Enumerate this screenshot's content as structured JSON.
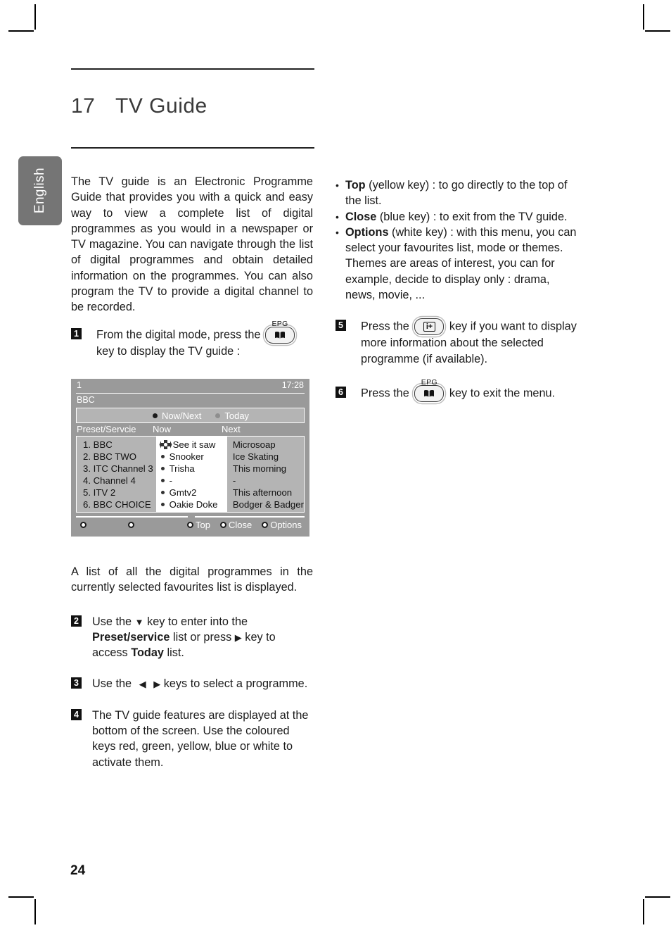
{
  "page": {
    "number": "24",
    "language_tab": "English",
    "chapter_number": "17",
    "chapter_title": "TV Guide"
  },
  "left_column": {
    "intro": "The TV guide is an Electronic Programme Guide that provides you with a quick and easy way to view a complete list of digital programmes as you would in a newspaper or TV magazine. You can navigate through the list of digital programmes and obtain detailed information on the programmes. You can also program the TV to provide a digital channel to be recorded.",
    "step1": {
      "badge": "1",
      "text_before": "From the digital mode, press the",
      "key_label": "EPG",
      "key_icon": "book-icon",
      "text_after": "key to display the TV guide :"
    },
    "after_screen": "A list of all the digital programmes in the currently selected favourites list is displayed.",
    "step2": {
      "badge": "2",
      "part1": "Use the",
      "arrow_down": "▼",
      "part2": "key to enter into the",
      "bold1": "Preset/service",
      "part3": "list or press",
      "arrow_right": "▶",
      "part4": "key to access",
      "bold2": "Today",
      "part5": "list."
    },
    "step3": {
      "badge": "3",
      "part1": "Use the",
      "arrow_left": "◀",
      "arrow_right": "▶",
      "part2": "keys to select a programme."
    },
    "step4": {
      "badge": "4",
      "text": "The TV guide features are displayed at the bottom of the screen. Use the coloured keys red, green, yellow, blue or white to activate them."
    }
  },
  "right_column": {
    "bullets": [
      {
        "bold": "Top",
        "rest": " (yellow key) : to go directly to the top of the list."
      },
      {
        "bold": "Close",
        "rest": " (blue key) : to exit from the TV guide."
      },
      {
        "bold": "Options",
        "rest": " (white key) : with this menu, you can select your favourites list, mode or themes. Themes are areas of interest, you can for example, decide to display only : drama, news, movie, ..."
      }
    ],
    "step5": {
      "badge": "5",
      "text_before": "Press the",
      "key_icon": "info-plus-icon",
      "key_glyph": "i+",
      "text_after": "key if you want to display more information about the selected programme (if available)."
    },
    "step6": {
      "badge": "6",
      "text_before": "Press the",
      "key_label": "EPG",
      "key_icon": "book-icon",
      "text_after": "key to exit the menu."
    }
  },
  "tv_guide_screen": {
    "preset_number": "1",
    "clock": "17:28",
    "channel": "BBC",
    "modes": [
      {
        "label": "Now/Next",
        "selected": true
      },
      {
        "label": "Today",
        "selected": false
      }
    ],
    "columns": [
      "Preset/Servcie",
      "Now",
      "Next"
    ],
    "rows": [
      {
        "preset": "1. BBC",
        "now": "See it saw",
        "next": "Microsoap",
        "cursor": true
      },
      {
        "preset": "2. BBC TWO",
        "now": "Snooker",
        "next": "Ice Skating",
        "cursor": false
      },
      {
        "preset": "3. ITC Channel 3",
        "now": "Trisha",
        "next": "This morning",
        "cursor": false
      },
      {
        "preset": "4. Channel 4",
        "now": "-",
        "next": "-",
        "cursor": false
      },
      {
        "preset": "5. ITV 2",
        "now": "Gmtv2",
        "next": "This afternoon",
        "cursor": false
      },
      {
        "preset": "6. BBC CHOICE",
        "now": "Oakie Doke",
        "next": "Bodger & Badger",
        "cursor": false
      }
    ],
    "footer_buttons": [
      {
        "label": "",
        "color": "#cc2222"
      },
      {
        "label": "",
        "color": "#22aa44"
      },
      {
        "label": "Top",
        "color": "#dddd22"
      },
      {
        "label": "Close",
        "color": "#2244cc"
      },
      {
        "label": "Options",
        "color": "#ffffff"
      }
    ],
    "colors": {
      "screen_bg": "#9a9a9a",
      "panel_bg": "#b4b4b4",
      "now_col_bg": "#ffffff",
      "text": "#ffffff"
    }
  }
}
